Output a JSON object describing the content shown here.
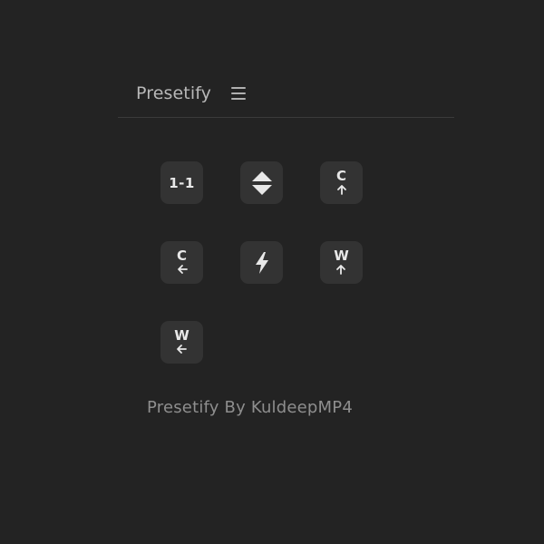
{
  "header": {
    "title": "Presetify",
    "menu_icon": "hamburger-icon"
  },
  "buttons": [
    {
      "id": "one-to-one",
      "label": "1-1",
      "icon": "text"
    },
    {
      "id": "expand",
      "label": "",
      "icon": "up-down-triangle-icon"
    },
    {
      "id": "cursor-up",
      "label": "C",
      "icon": "arrow-up-icon"
    },
    {
      "id": "cursor-left",
      "label": "C",
      "icon": "arrow-left-icon"
    },
    {
      "id": "flash",
      "label": "",
      "icon": "lightning-icon"
    },
    {
      "id": "width-up",
      "label": "W",
      "icon": "arrow-up-icon"
    },
    {
      "id": "width-left",
      "label": "W",
      "icon": "arrow-left-icon"
    }
  ],
  "footer": {
    "text": "Presetify By KuldeepMP4"
  },
  "colors": {
    "background": "#232323",
    "button": "#333333",
    "icon": "#e8e8e8",
    "title": "#b7b7b7",
    "footer": "#8e8e8e",
    "divider": "#3b3b3b"
  }
}
